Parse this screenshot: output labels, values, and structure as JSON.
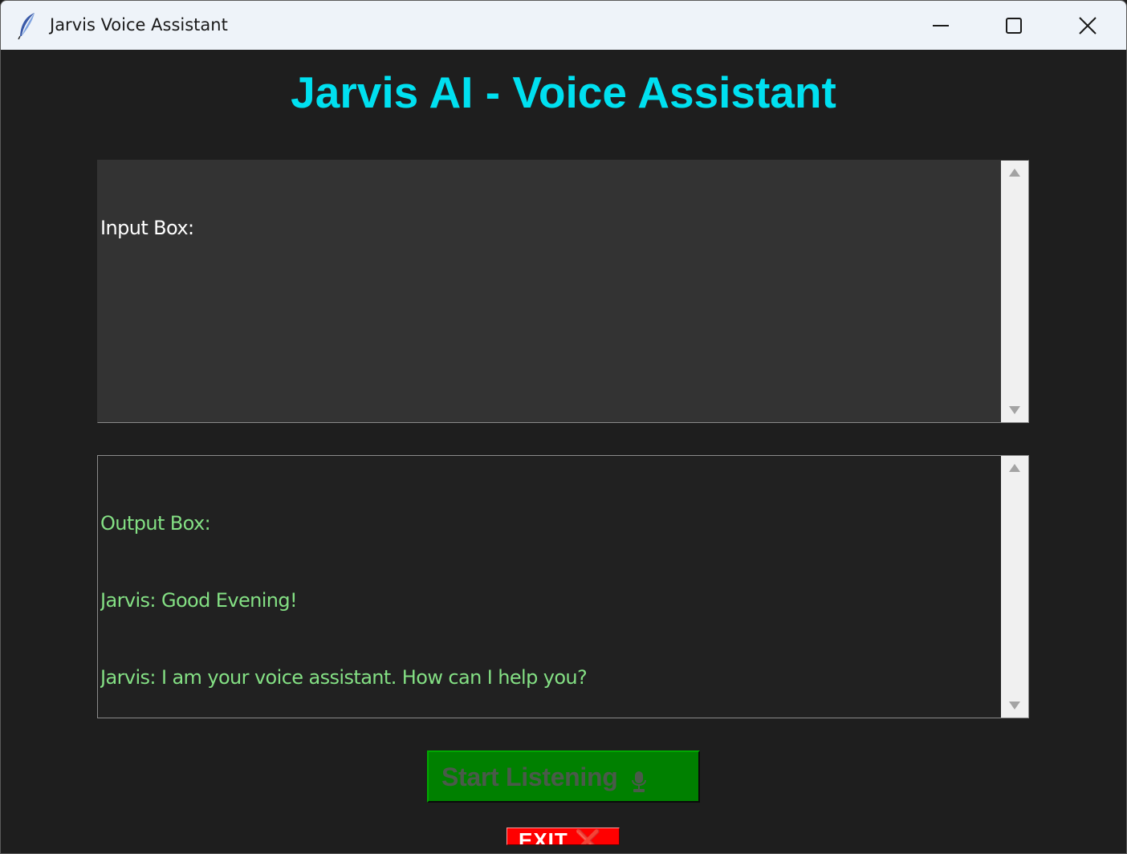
{
  "window": {
    "title": "Jarvis Voice Assistant",
    "icon": "feather-icon",
    "controls": [
      "minimize-icon",
      "maximize-icon",
      "close-icon"
    ]
  },
  "main": {
    "heading": "Jarvis AI - Voice Assistant",
    "input_box": {
      "lines": [
        "Input Box:"
      ]
    },
    "output_box": {
      "lines": [
        "Output Box:",
        "Jarvis: Good Evening!",
        "Jarvis: I am your voice assistant. How can I help you?"
      ]
    },
    "buttons": {
      "listen_label": "Start Listening",
      "listen_icon": "microphone-icon",
      "exit_label": "EXIT ❌"
    }
  },
  "colors": {
    "background": "#1e1e1e",
    "heading": "#00e0f0",
    "input_bg": "#333333",
    "output_bg": "#212121",
    "output_text": "#84e084",
    "listen_button": "#008000",
    "exit_button": "#ff0000"
  }
}
